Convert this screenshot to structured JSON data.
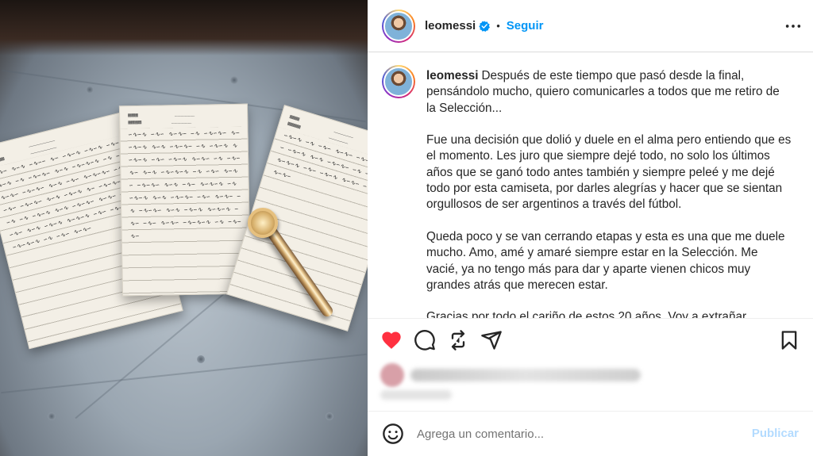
{
  "colors": {
    "accent": "#0095f6",
    "like_red": "#ff3040",
    "publish_disabled": "#b3dbff",
    "text": "#262626",
    "muted": "#737373"
  },
  "header": {
    "username": "leomessi",
    "separator": "•",
    "follow_label": "Seguir",
    "verified_icon": "verified-badge-icon",
    "more_icon": "more-options-icon"
  },
  "caption": {
    "username": "leomessi",
    "paragraphs": [
      "Después de este tiempo que pasó desde la final, pensándolo mucho, quiero comunicarles a todos que me retiro de la Selección...",
      "Fue una decisión que dolió y duele en el alma pero entiendo que es el momento. Les juro que siempre dejé todo, no solo los últimos años que se ganó todo antes también y siempre peleé y me dejé todo por esta camiseta, por darles alegrías y hacer que se sientan orgullosos de ser argentinos a través del fútbol.",
      "Queda poco y se van cerrando etapas y esta es una que me duele mucho. Amo, amé y amaré siempre estar en la Selección. Me vacié, ya no tengo más para dar y aparte vienen chicos muy grandes atrás que merecen estar.",
      "Gracias por todo el cariño de estos 20 años. Voy a extrañar"
    ]
  },
  "actions": {
    "like_icon": "heart-filled-icon",
    "comment_icon": "comment-icon",
    "repost_icon": "repost-icon",
    "share_icon": "share-icon",
    "save_icon": "bookmark-icon",
    "liked": true
  },
  "comment_bar": {
    "emoji_icon": "emoji-icon",
    "placeholder": "Agrega un comentario...",
    "publish_label": "Publicar"
  }
}
